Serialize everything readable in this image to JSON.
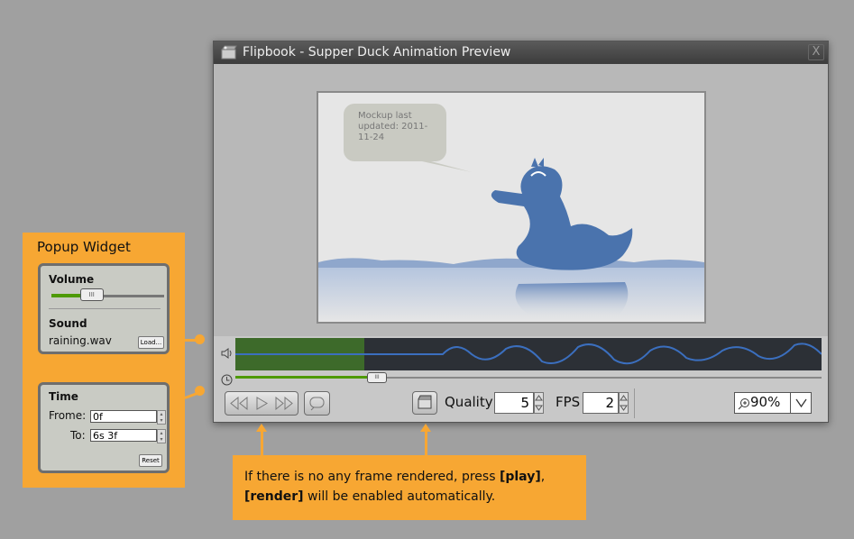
{
  "window": {
    "title": "Flipbook - Supper Duck Animation Preview",
    "close_label": "X"
  },
  "canvas": {
    "bubble_text": "Mockup last updated: 2011-11-24"
  },
  "toolbar": {
    "quality_label": "Quality",
    "quality_value": "5",
    "fps_label": "FPS",
    "fps_value": "2",
    "zoom_value": "90%"
  },
  "timeline": {
    "played_fraction": 0.22,
    "slider_fraction": 0.24
  },
  "popup": {
    "title": "Popup Widget",
    "volume_label": "Volume",
    "volume_fraction": 0.35,
    "sound_label": "Sound",
    "sound_file": "raining.wav",
    "load_label": "Load...",
    "time_label": "Time",
    "from_label": "Frome:",
    "from_value": "0f",
    "to_label": "To:",
    "to_value": "6s 3f",
    "reset_label": "Reset"
  },
  "note": {
    "part1": "If there is no any frame rendered, press ",
    "play": "[play]",
    "part2": ",",
    "render": "[render]",
    "part3": " will be enabled automatically."
  },
  "colors": {
    "accent": "#f7a733",
    "duck": "#4a73ad",
    "played": "#3d6a2a",
    "wave": "#3b6fbf"
  }
}
